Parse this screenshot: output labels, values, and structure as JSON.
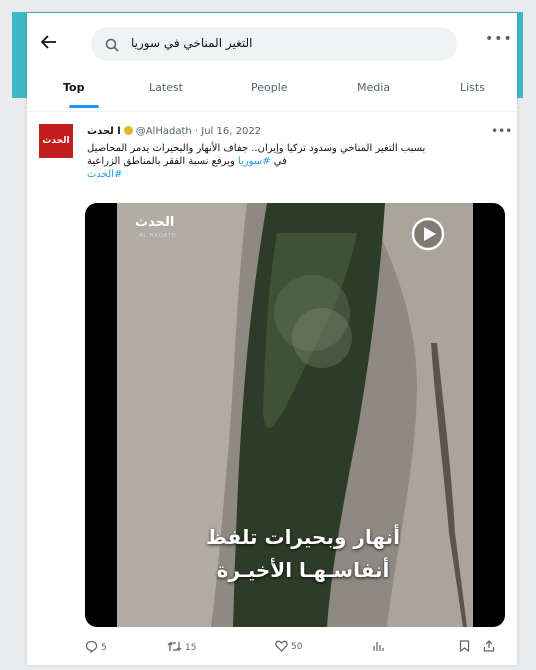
{
  "search": {
    "query": "التغير المناخي في سوريا"
  },
  "tabs": [
    {
      "label": "Top"
    },
    {
      "label": "Latest"
    },
    {
      "label": "People"
    },
    {
      "label": "Media"
    },
    {
      "label": "Lists"
    }
  ],
  "tweet": {
    "avatar_text": "الحدث",
    "author_name": "ا لحدث",
    "handle": "@AlHadath",
    "date": "Jul 16, 2022",
    "text_line1": "بسبب التغير المناخي وسدود تركيا وإيران.. جفاف الأنهار والبحيرات يدمر المحاصيل",
    "text_line2_pre": "في ",
    "text_line2_hashtag": "#سوريا",
    "text_line2_post": " ويرفع نسبة الفقر بالمناطق الزراعية",
    "text_line3_hashtag": "#الحدث",
    "media": {
      "logo": "الحدث",
      "logo_sub": "AL HADATH",
      "caption_line1": "أنهار وبحيرات تلفظ",
      "caption_line2": "أنفاسـهـا الأخيـرة"
    },
    "replies": "5",
    "retweets": "15",
    "likes": "50"
  },
  "colors": {
    "accent": "#1d9bf0",
    "frame": "#3fb8c8",
    "brand_red": "#c41d1d"
  }
}
